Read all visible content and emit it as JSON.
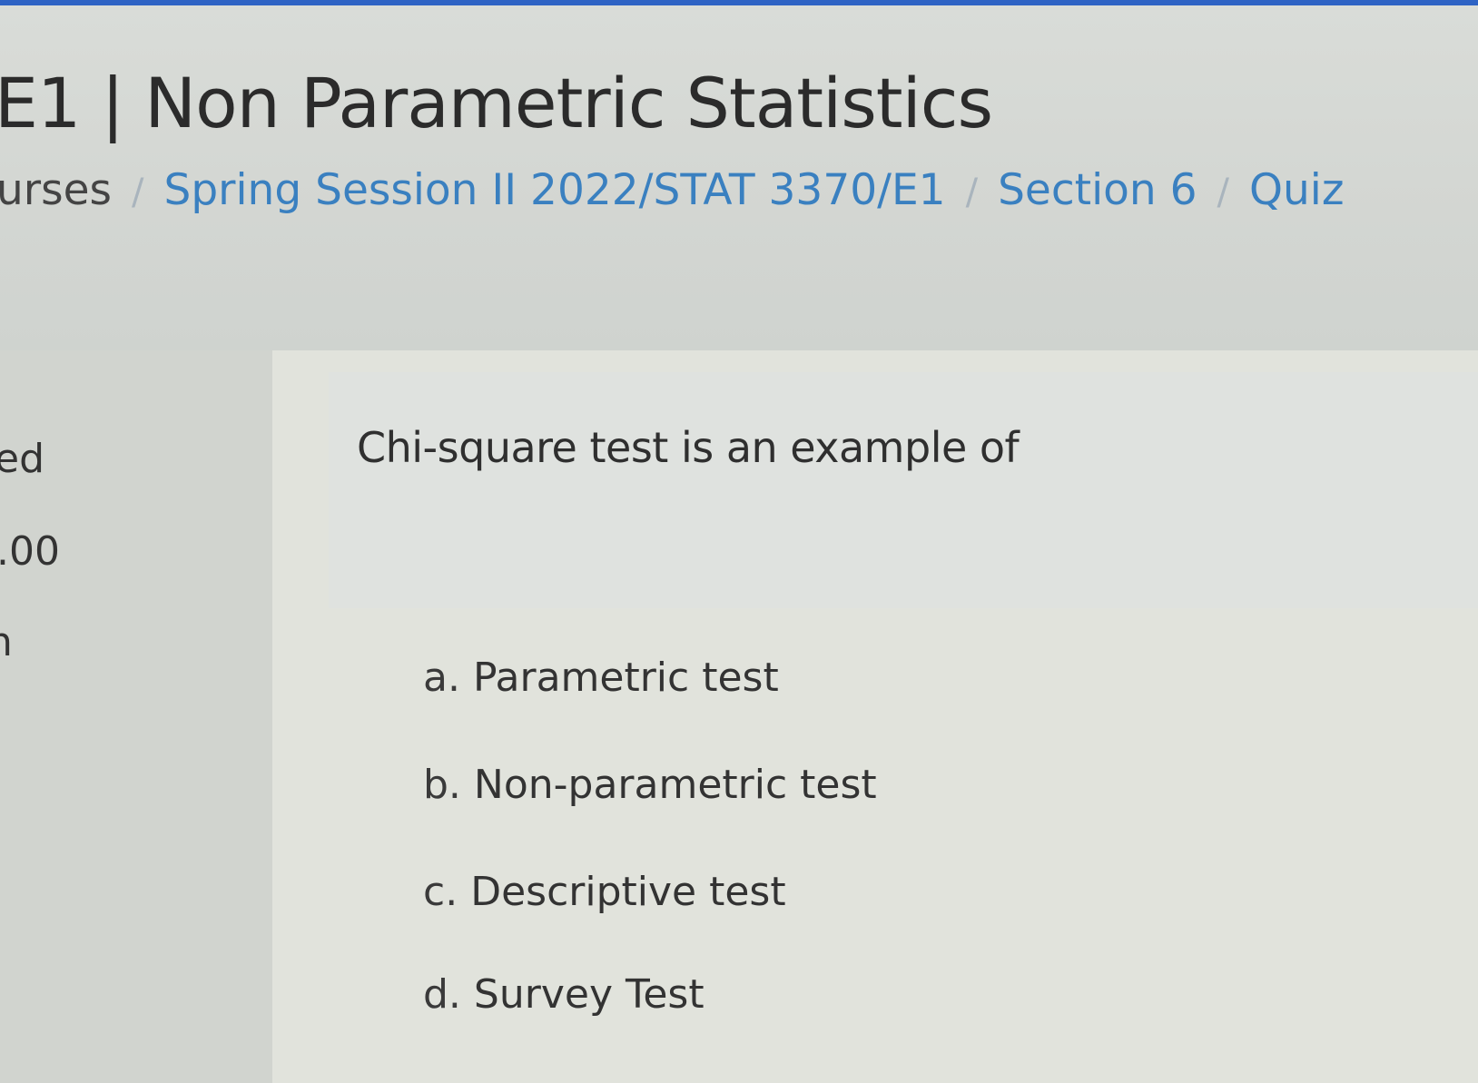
{
  "header": {
    "title": "E1 | Non Parametric Statistics"
  },
  "breadcrumb": {
    "items": [
      "urses",
      "Spring Session II 2022/STAT 3370/E1",
      "Section 6",
      "Quiz"
    ],
    "separator": "/"
  },
  "quiz_info": {
    "partial_labels": [
      "ed",
      ".00",
      "n"
    ]
  },
  "question": {
    "text": "Chi-square test is an example of",
    "answers": [
      {
        "letter": "a.",
        "label": "Parametric test"
      },
      {
        "letter": "b.",
        "label": "Non-parametric test"
      },
      {
        "letter": "c.",
        "label": "Descriptive test"
      },
      {
        "letter": "d.",
        "label": "Survey Test"
      }
    ]
  },
  "colors": {
    "accent_strip": "#2e63c4",
    "link": "#3a80c0",
    "text": "#333333"
  }
}
